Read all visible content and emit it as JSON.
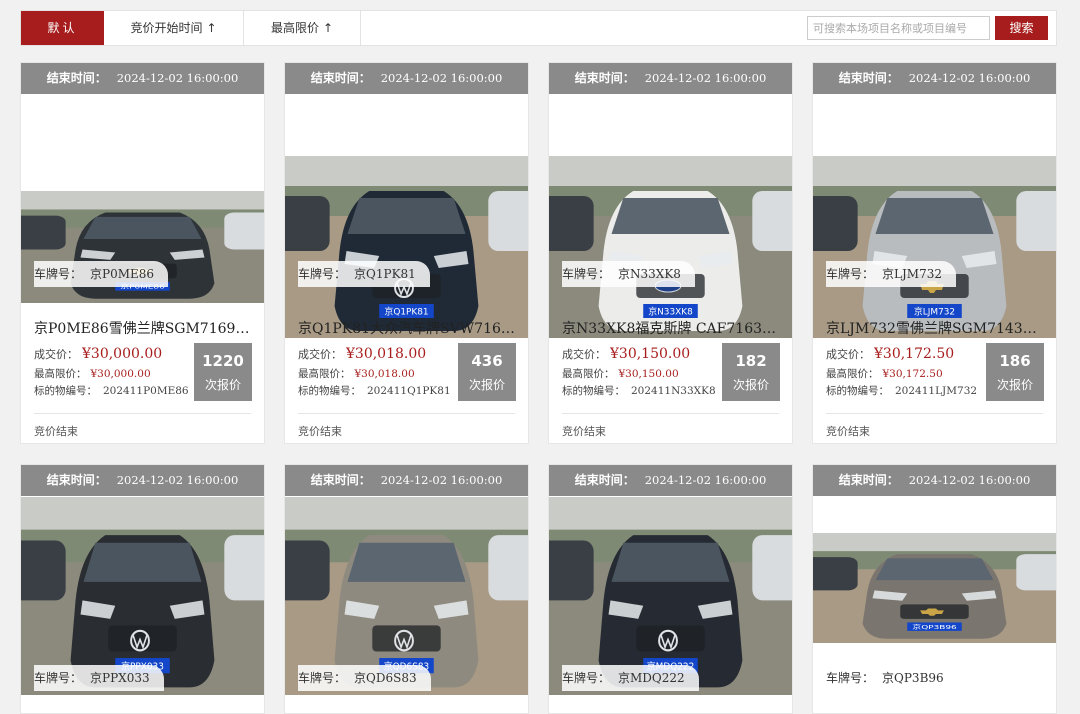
{
  "toolbar": {
    "sort_default": "默认",
    "sort_start_time": "竞价开始时间",
    "sort_max_price": "最高限价",
    "sort_arrow": "↑",
    "search_placeholder": "可搜索本场项目名称或项目编号",
    "search_button": "搜索"
  },
  "labels": {
    "end_time": "结束时间：",
    "plate": "车牌号：",
    "deal_price": "成交价：",
    "max_price": "最高限价：",
    "item_no": "标的物编号：",
    "bids_unit": "次报价"
  },
  "colors": {
    "accent": "#a71d1d",
    "header_gray": "#8a8a8a"
  },
  "cards": [
    {
      "end_time": "2024-12-02 16:00:00",
      "plate": "京P0ME86",
      "title": "京P0ME86雪佛兰牌SGM7169MTA…",
      "deal_price": "¥30,000.00",
      "max_price": "¥30,000.00",
      "item_no": "202411P0ME86",
      "bids": "1220",
      "status": "竞价结束",
      "photo_plate": "京P0ME86",
      "car_color": "#2e3338",
      "logo": "chevy"
    },
    {
      "end_time": "2024-12-02 16:00:00",
      "plate": "京Q1PK81",
      "title": "京Q1PK81大众汽车牌SVW71612T…",
      "deal_price": "¥30,018.00",
      "max_price": "¥30,018.00",
      "item_no": "202411Q1PK81",
      "bids": "436",
      "status": "竞价结束",
      "photo_plate": "京Q1PK81",
      "car_color": "#1f2a36",
      "logo": "vw"
    },
    {
      "end_time": "2024-12-02 16:00:00",
      "plate": "京N33XK8",
      "title": "京N33XK8福克斯牌 CAF7163B4白…",
      "deal_price": "¥30,150.00",
      "max_price": "¥30,150.00",
      "item_no": "202411N33XK8",
      "bids": "182",
      "status": "竞价结束",
      "photo_plate": "京N33XK8",
      "car_color": "#ececea",
      "logo": "ford"
    },
    {
      "end_time": "2024-12-02 16:00:00",
      "plate": "京LJM732",
      "title": "京LJM732雪佛兰牌SGM7143MTB…",
      "deal_price": "¥30,172.50",
      "max_price": "¥30,172.50",
      "item_no": "202411LJM732",
      "bids": "186",
      "status": "竞价结束",
      "photo_plate": "京LJM732",
      "car_color": "#b9bcbf",
      "logo": "chevy"
    },
    {
      "end_time": "2024-12-02 16:00:00",
      "plate": "京PPX033",
      "photo_plate": "京PPX033",
      "car_color": "#2a2d31",
      "logo": "vw"
    },
    {
      "end_time": "2024-12-02 16:00:00",
      "plate": "京QD6S83",
      "photo_plate": "京QD6S83",
      "car_color": "#8f8a80",
      "logo": "vw"
    },
    {
      "end_time": "2024-12-02 16:00:00",
      "plate": "京MDQ222",
      "photo_plate": "京MDQ222",
      "car_color": "#262b33",
      "logo": "vw"
    },
    {
      "end_time": "2024-12-02 16:00:00",
      "plate": "京QP3B96",
      "photo_plate": "京QP3B96",
      "car_color": "#7a756e",
      "logo": "chevy"
    }
  ]
}
